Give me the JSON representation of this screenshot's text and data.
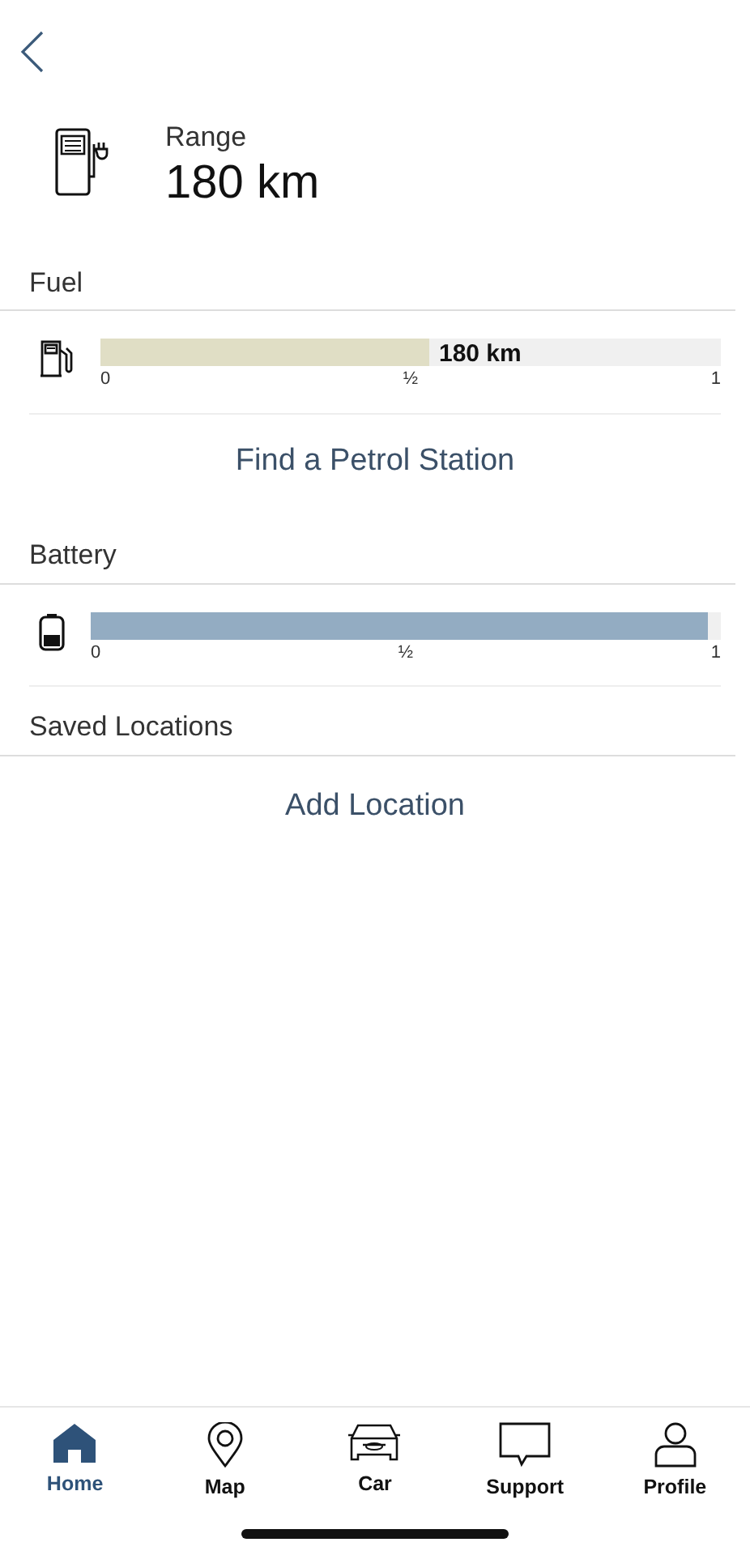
{
  "range": {
    "label": "Range",
    "value": "180 km"
  },
  "sections": [
    {
      "title": "Fuel",
      "gauge": {
        "level": 0.53,
        "reading": "180 km",
        "ticks": [
          "0",
          "½",
          "1"
        ]
      },
      "action": "Find a Petrol Station"
    },
    {
      "title": "Battery",
      "gauge": {
        "level": 0.98,
        "ticks": [
          "0",
          "½",
          "1"
        ]
      }
    },
    {
      "title": "Saved Locations",
      "action": "Add Location"
    }
  ],
  "tabs": [
    {
      "label": "Home",
      "selected": true
    },
    {
      "label": "Map",
      "selected": false
    },
    {
      "label": "Car",
      "selected": false
    },
    {
      "label": "Support",
      "selected": false
    },
    {
      "label": "Profile",
      "selected": false
    }
  ]
}
